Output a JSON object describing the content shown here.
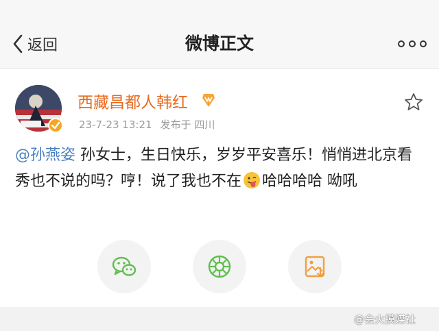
{
  "nav": {
    "back_label": "返回",
    "title": "微博正文",
    "back_icon": "chevron-left-icon",
    "more_icon": "more-dots-icon"
  },
  "post": {
    "author": "西藏昌都人韩红",
    "timestamp": "23-7-23 13:21",
    "source": "发布于 四川",
    "mention": "@孙燕姿",
    "text_before_emoji": " 孙女士，生日快乐，岁岁平安喜乐！悄悄进北京看秀也不说的吗？哼！说了我也不在",
    "text_after_emoji": "哈哈哈哈 呦吼",
    "emoji_icon": "tongue-face-emoji",
    "badge_icon": "vip-badge-icon",
    "verified_icon": "verified-icon",
    "favorite_icon": "star-icon"
  },
  "actions": [
    {
      "name": "share-wechat",
      "icon": "wechat-icon",
      "color": "#5fbf4f"
    },
    {
      "name": "share-moments",
      "icon": "wechat-moments-icon",
      "color": "#5fbf4f"
    },
    {
      "name": "save-image",
      "icon": "save-image-icon",
      "color": "#f0a040"
    }
  ],
  "colors": {
    "username": "#e86a1f",
    "mention": "#4a7fc2",
    "meta": "#9a9a9a"
  },
  "watermark": "@会火摸媒社"
}
